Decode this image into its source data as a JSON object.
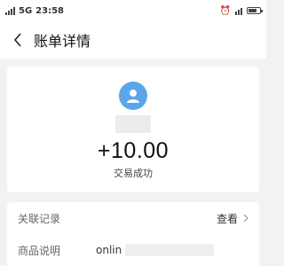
{
  "status_bar": {
    "left_text": "23:58",
    "signal_label": "5G"
  },
  "header": {
    "title": "账单详情"
  },
  "transaction": {
    "amount": "+10.00",
    "status": "交易成功"
  },
  "details": {
    "rows": [
      {
        "label": "关联记录",
        "action": "查看"
      },
      {
        "label": "商品说明",
        "value": "onlin"
      }
    ]
  },
  "colors": {
    "avatar": "#5aa6e8"
  }
}
